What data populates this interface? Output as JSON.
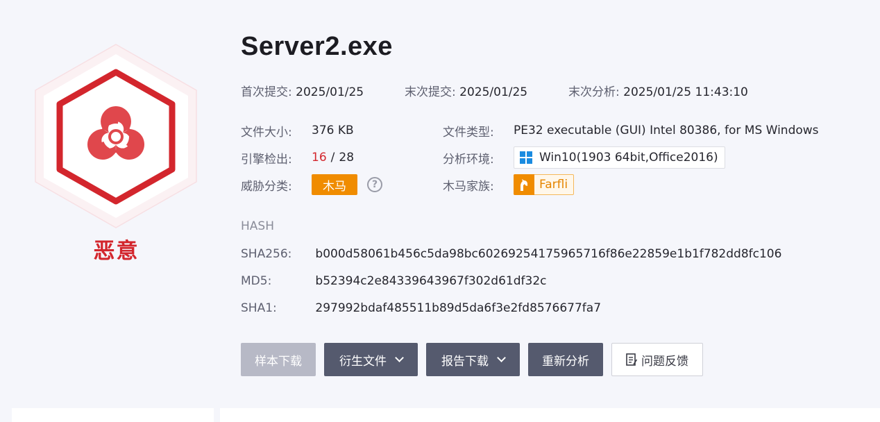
{
  "verdict": {
    "label": "恶意",
    "icon": "biohazard-icon",
    "color": "#d3262d"
  },
  "file": {
    "name": "Server2.exe"
  },
  "dates": {
    "first_submit_label": "首次提交:",
    "first_submit_value": "2025/01/25",
    "last_submit_label": "末次提交:",
    "last_submit_value": "2025/01/25",
    "last_analysis_label": "末次分析:",
    "last_analysis_value": "2025/01/25 11:43:10"
  },
  "details": {
    "size_label": "文件大小:",
    "size_value": "376 KB",
    "type_label": "文件类型:",
    "type_value": "PE32 executable (GUI) Intel 80386, for MS Windows",
    "engine_label": "引擎检出:",
    "engine_detected": "16",
    "engine_separator": "/",
    "engine_total": "28",
    "env_label": "分析环境:",
    "env_value": "Win10(1903 64bit,Office2016)",
    "env_icon": "windows-icon",
    "threat_label": "威胁分类:",
    "threat_value": "木马",
    "threat_color": "#f08c00",
    "help_icon": "question-circle-icon",
    "help_glyph": "?",
    "family_label": "木马家族:",
    "family_value": "Farfli",
    "family_icon": "trojan-horse-icon"
  },
  "hash": {
    "heading": "HASH",
    "sha256_label": "SHA256:",
    "sha256_value": "b000d58061b456c5da98bc6026925417596571 6f86e22859e1b1f782dd8fc106",
    "md5_label": "MD5:",
    "md5_value": "b52394c2e84339643967f302d61df32c",
    "sha1_label": "SHA1:",
    "sha1_value": "297992bdaf485511b89d5da6f3e2fd8576677fa7"
  },
  "actions": {
    "sample_download": "样本下载",
    "derived_files": "衍生文件",
    "report_download": "报告下载",
    "reanalyze": "重新分析",
    "feedback": "问题反馈"
  }
}
